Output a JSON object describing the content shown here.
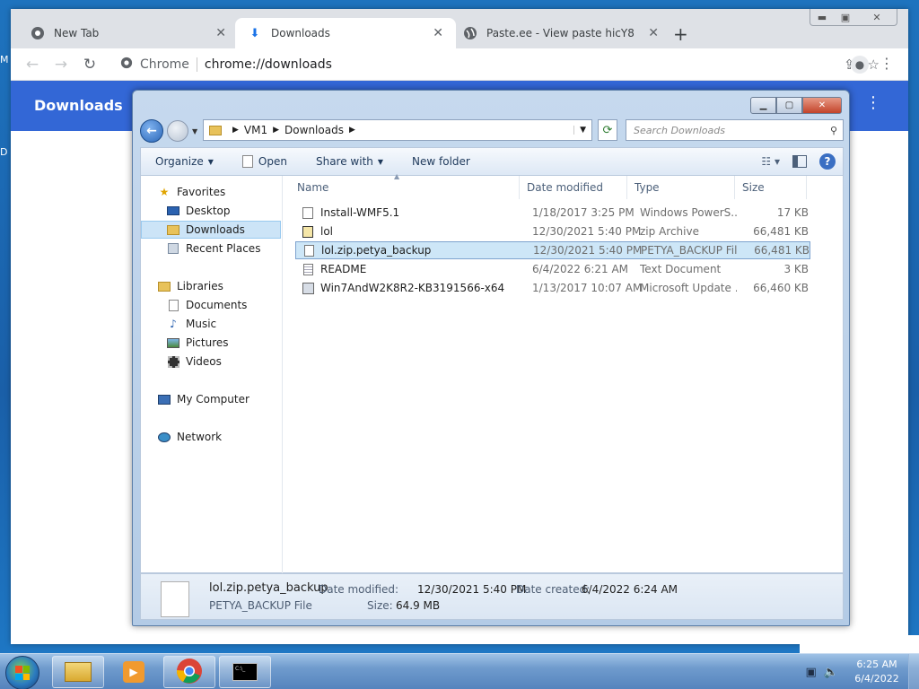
{
  "desktop": {
    "edge_letters": [
      "M",
      "D"
    ]
  },
  "chrome": {
    "tabs": [
      {
        "label": "New Tab",
        "icon": "chrome-icon"
      },
      {
        "label": "Downloads",
        "icon": "download-icon"
      },
      {
        "label": "Paste.ee - View paste hicY8",
        "icon": "globe-icon"
      }
    ],
    "address_prefix": "Chrome",
    "url": "chrome://downloads",
    "page_title": "Downloads"
  },
  "explorer": {
    "breadcrumb": [
      "VM1",
      "Downloads"
    ],
    "search_placeholder": "Search Downloads",
    "commands": {
      "organize": "Organize",
      "open": "Open",
      "share": "Share with",
      "new_folder": "New folder"
    },
    "nav": {
      "favorites": "Favorites",
      "desktop": "Desktop",
      "downloads": "Downloads",
      "recent": "Recent Places",
      "libraries": "Libraries",
      "documents": "Documents",
      "music": "Music",
      "pictures": "Pictures",
      "videos": "Videos",
      "computer": "My Computer",
      "network": "Network"
    },
    "columns": {
      "name": "Name",
      "date": "Date modified",
      "type": "Type",
      "size": "Size"
    },
    "files": [
      {
        "name": "Install-WMF5.1",
        "date": "1/18/2017 3:25 PM",
        "type": "Windows PowerS...",
        "size": "17 KB"
      },
      {
        "name": "lol",
        "date": "12/30/2021 5:40 PM",
        "type": "zip Archive",
        "size": "66,481 KB"
      },
      {
        "name": "lol.zip.petya_backup",
        "date": "12/30/2021 5:40 PM",
        "type": "PETYA_BACKUP File",
        "size": "66,481 KB"
      },
      {
        "name": "README",
        "date": "6/4/2022 6:21 AM",
        "type": "Text Document",
        "size": "3 KB"
      },
      {
        "name": "Win7AndW2K8R2-KB3191566-x64",
        "date": "1/13/2017 10:07 AM",
        "type": "Microsoft Update ...",
        "size": "66,460 KB"
      }
    ],
    "details": {
      "name": "lol.zip.petya_backup",
      "type": "PETYA_BACKUP File",
      "modified_label": "Date modified:",
      "modified": "12/30/2021 5:40 PM",
      "created_label": "Date created:",
      "created": "6/4/2022 6:24 AM",
      "size_label": "Size:",
      "size": "64.9 MB"
    }
  },
  "taskbar": {
    "time": "6:25 AM",
    "date": "6/4/2022"
  }
}
